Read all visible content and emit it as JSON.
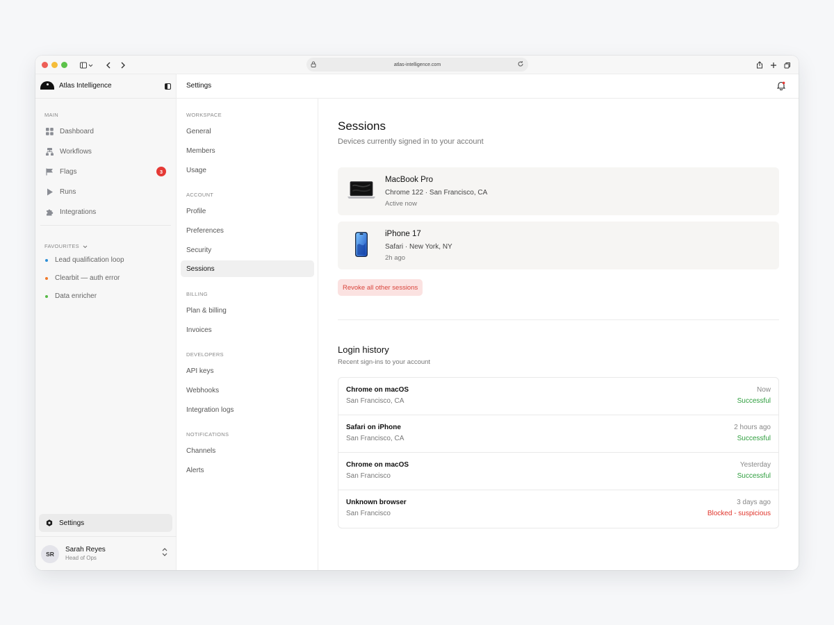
{
  "browser": {
    "url": "atlas-intelligence.com"
  },
  "brand": {
    "name": "Atlas Intelligence"
  },
  "sidebar": {
    "main_label": "MAIN",
    "items": [
      {
        "label": "Dashboard",
        "icon": "grid-icon"
      },
      {
        "label": "Workflows",
        "icon": "workflow-icon"
      },
      {
        "label": "Flags",
        "icon": "flag-icon",
        "badge": "3"
      },
      {
        "label": "Runs",
        "icon": "play-icon"
      },
      {
        "label": "Integrations",
        "icon": "puzzle-icon"
      }
    ],
    "favourites_label": "FAVOURITES",
    "favourites": [
      {
        "label": "Lead qualification loop",
        "color": "#2d8fd6"
      },
      {
        "label": "Clearbit — auth error",
        "color": "#f07a2a"
      },
      {
        "label": "Data enricher",
        "color": "#57b947"
      }
    ],
    "settings_label": "Settings",
    "user": {
      "initials": "SR",
      "name": "Sarah Reyes",
      "role": "Head of Ops"
    }
  },
  "header": {
    "crumb": "Settings"
  },
  "subnav": {
    "groups": [
      {
        "label": "WORKSPACE",
        "items": [
          "General",
          "Members",
          "Usage"
        ]
      },
      {
        "label": "ACCOUNT",
        "items": [
          "Profile",
          "Preferences",
          "Security",
          "Sessions"
        ]
      },
      {
        "label": "BILLING",
        "items": [
          "Plan & billing",
          "Invoices"
        ]
      },
      {
        "label": "DEVELOPERS",
        "items": [
          "API keys",
          "Webhooks",
          "Integration logs"
        ]
      },
      {
        "label": "NOTIFICATIONS",
        "items": [
          "Channels",
          "Alerts"
        ]
      }
    ],
    "active": "Sessions"
  },
  "sessions": {
    "title": "Sessions",
    "subtitle": "Devices currently signed in to your account",
    "devices": [
      {
        "name": "MacBook Pro",
        "browser": "Chrome 122 · San Francisco, CA",
        "time": "Active now",
        "icon": "laptop-icon"
      },
      {
        "name": "iPhone 17",
        "browser": "Safari · New York, NY",
        "time": "2h ago",
        "icon": "phone-icon"
      }
    ],
    "revoke_label": "Revoke all other sessions"
  },
  "history": {
    "title": "Login history",
    "subtitle": "Recent sign-ins to your account",
    "rows": [
      {
        "browser": "Chrome on macOS",
        "location": "San Francisco, CA",
        "when": "Now",
        "status": "Successful",
        "status_color": "#2e9e3e"
      },
      {
        "browser": "Safari on iPhone",
        "location": "San Francisco, CA",
        "when": "2 hours ago",
        "status": "Successful",
        "status_color": "#2e9e3e"
      },
      {
        "browser": "Chrome on macOS",
        "location": "San Francisco",
        "when": "Yesterday",
        "status": "Successful",
        "status_color": "#2e9e3e"
      },
      {
        "browser": "Unknown browser",
        "location": "San Francisco",
        "when": "3 days ago",
        "status": "Blocked - suspicious",
        "status_color": "#e0342b"
      }
    ]
  },
  "colors": {
    "badge": "#e53935",
    "revoke_bg": "#fbe2e1",
    "revoke_text": "#d9453c"
  }
}
